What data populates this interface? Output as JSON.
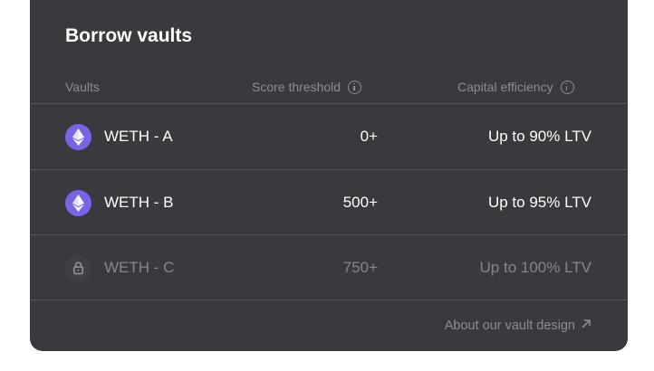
{
  "panel": {
    "title": "Borrow vaults",
    "columns": {
      "vaults": "Vaults",
      "score_threshold": "Score threshold",
      "capital_efficiency": "Capital efficiency"
    },
    "rows": [
      {
        "name": "WETH - A",
        "score": "0+",
        "ltv": "Up to 90% LTV",
        "icon": "ethereum-icon",
        "locked": false
      },
      {
        "name": "WETH - B",
        "score": "500+",
        "ltv": "Up to 95% LTV",
        "icon": "ethereum-icon",
        "locked": false
      },
      {
        "name": "WETH - C",
        "score": "750+",
        "ltv": "Up to 100% LTV",
        "icon": "lock-icon",
        "locked": true
      }
    ],
    "footer_link": "About our vault design"
  },
  "colors": {
    "panel_bg": "#3a3a3e",
    "accent_purple": "#7a64e6",
    "muted_text": "#8c8c92",
    "divider": "#55555a"
  }
}
